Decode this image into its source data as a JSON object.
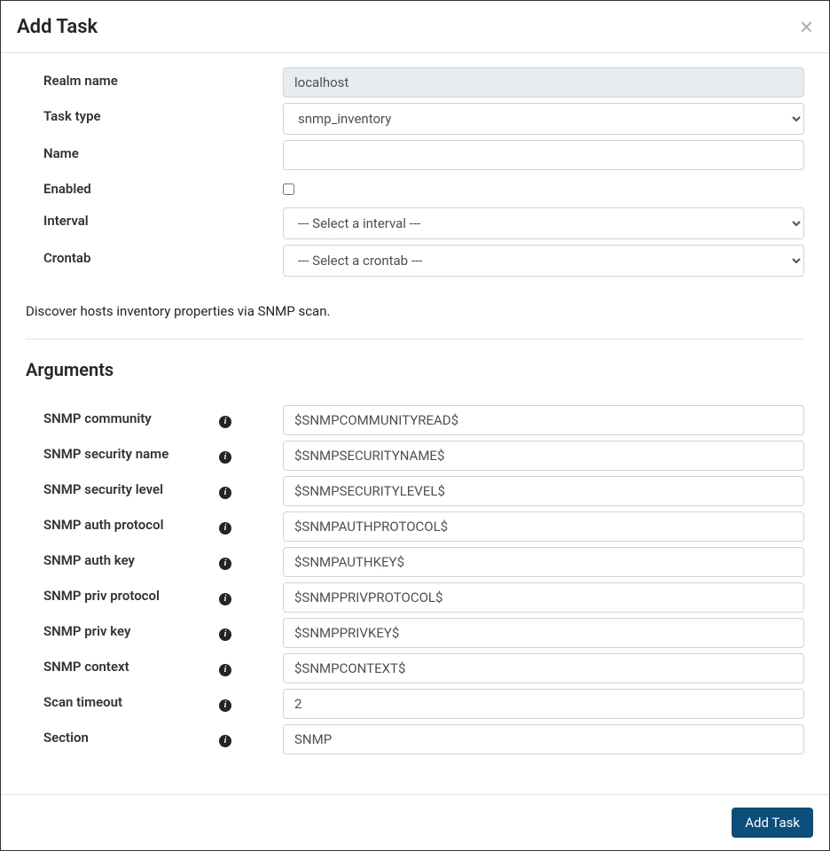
{
  "modal": {
    "title": "Add Task",
    "close_label": "×",
    "submit_label": "Add Task"
  },
  "form": {
    "realm_name": {
      "label": "Realm name",
      "value": "localhost"
    },
    "task_type": {
      "label": "Task type",
      "value": "snmp_inventory"
    },
    "name": {
      "label": "Name",
      "value": ""
    },
    "enabled": {
      "label": "Enabled",
      "checked": false
    },
    "interval": {
      "label": "Interval",
      "value": "--- Select a interval ---"
    },
    "crontab": {
      "label": "Crontab",
      "value": "--- Select a crontab ---"
    }
  },
  "description": "Discover hosts inventory properties via SNMP scan.",
  "arguments_title": "Arguments",
  "arguments": [
    {
      "label": "SNMP community",
      "value": "$SNMPCOMMUNITYREAD$"
    },
    {
      "label": "SNMP security name",
      "value": "$SNMPSECURITYNAME$"
    },
    {
      "label": "SNMP security level",
      "value": "$SNMPSECURITYLEVEL$"
    },
    {
      "label": "SNMP auth protocol",
      "value": "$SNMPAUTHPROTOCOL$"
    },
    {
      "label": "SNMP auth key",
      "value": "$SNMPAUTHKEY$"
    },
    {
      "label": "SNMP priv protocol",
      "value": "$SNMPPRIVPROTOCOL$"
    },
    {
      "label": "SNMP priv key",
      "value": "$SNMPPRIVKEY$"
    },
    {
      "label": "SNMP context",
      "value": "$SNMPCONTEXT$"
    },
    {
      "label": "Scan timeout",
      "value": "2"
    },
    {
      "label": "Section",
      "value": "SNMP"
    }
  ]
}
